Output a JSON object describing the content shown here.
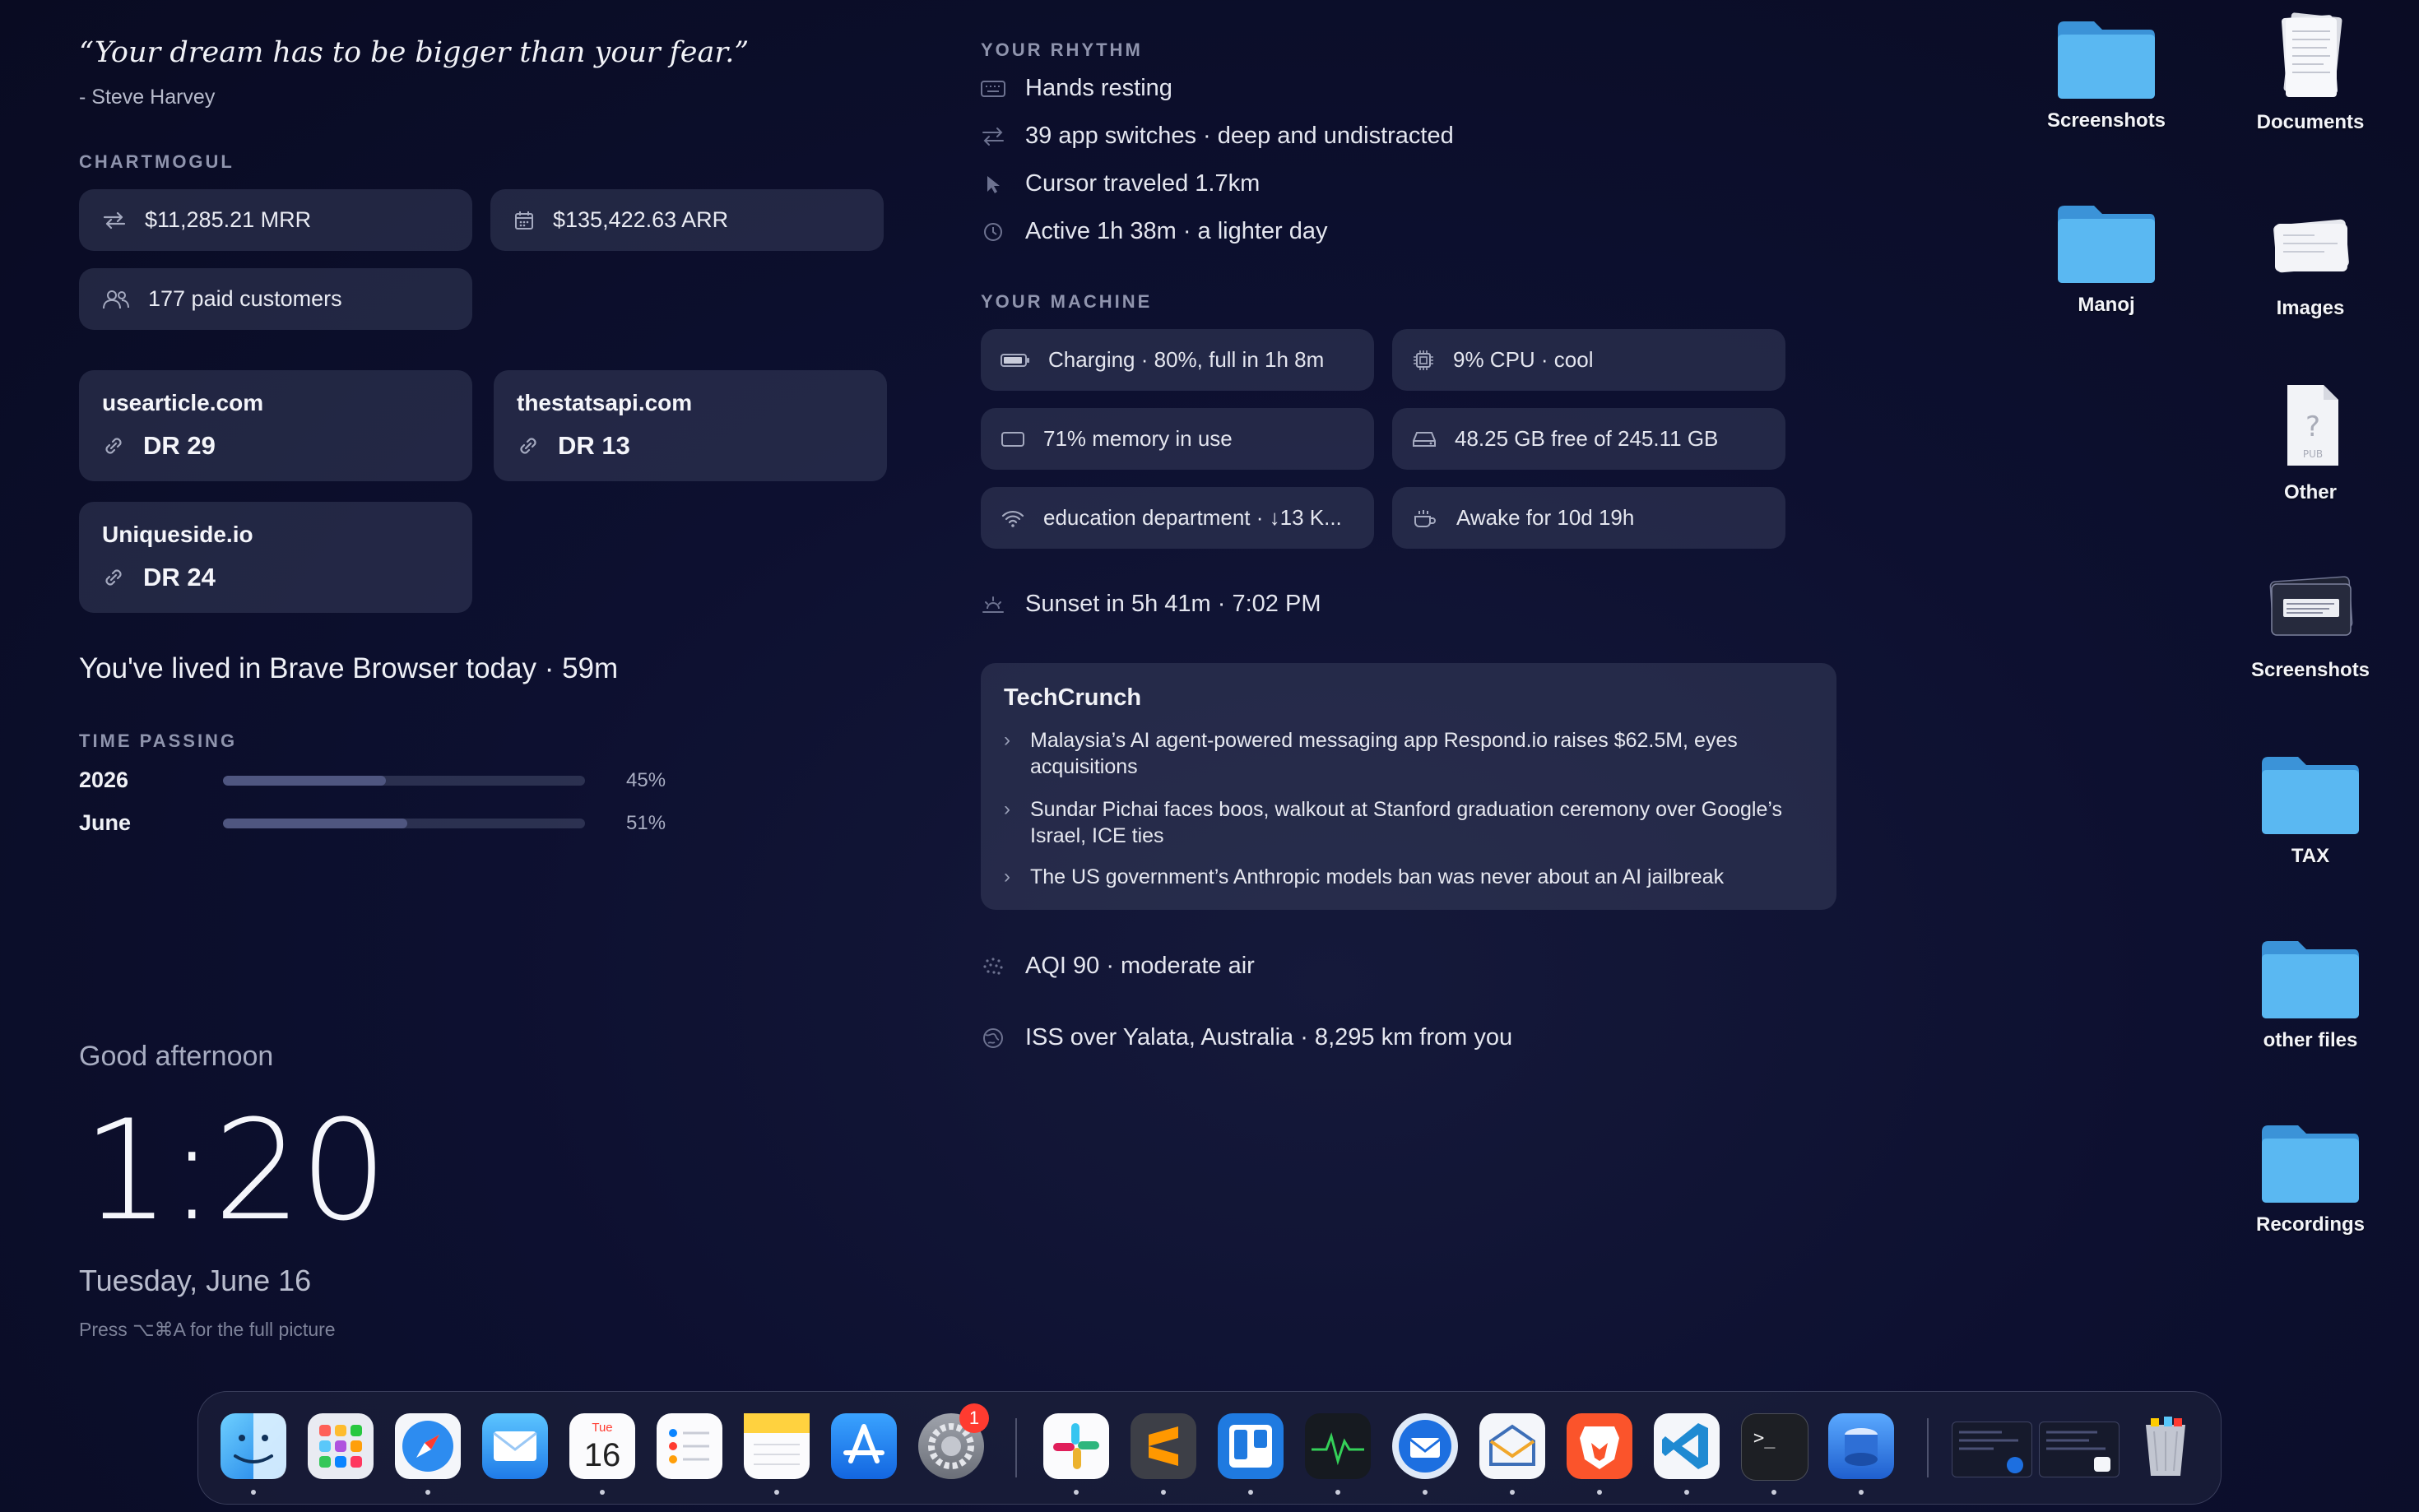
{
  "quote": {
    "text": "“Your dream has to be bigger than your fear.”",
    "author": "- Steve Harvey"
  },
  "chartmogul": {
    "label": "CHARTMOGUL",
    "mrr": "$11,285.21 MRR",
    "arr": "$135,422.63 ARR",
    "customers": "177 paid customers"
  },
  "sites": [
    {
      "name": "usearticle.com",
      "dr": "DR 29"
    },
    {
      "name": "thestatsapi.com",
      "dr": "DR 13"
    },
    {
      "name": "Uniqueside.io",
      "dr": "DR 24"
    }
  ],
  "lived": "You've lived in Brave Browser today · 59m",
  "time_passing": {
    "label": "TIME PASSING",
    "rows": [
      {
        "label": "2026",
        "value": 45,
        "pct": "45%"
      },
      {
        "label": "June",
        "value": 51,
        "pct": "51%"
      }
    ]
  },
  "clock": {
    "greeting": "Good afternoon",
    "time": "1:20",
    "date": "Tuesday, June 16",
    "hint": "Press ⌥⌘A for the full picture"
  },
  "rhythm": {
    "label": "YOUR RHYTHM",
    "items": [
      "Hands resting",
      "39 app switches · deep and undistracted",
      "Cursor traveled 1.7km",
      "Active 1h 38m · a lighter day"
    ]
  },
  "machine": {
    "label": "YOUR MACHINE",
    "battery": "Charging · 80%, full in 1h 8m",
    "cpu": "9% CPU · cool",
    "memory": "71% memory in use",
    "disk": "48.25 GB free of 245.11 GB",
    "wifi": "education department  · ↓13 K...",
    "uptime": "Awake for 10d 19h"
  },
  "sunset": "Sunset in 5h 41m · 7:02 PM",
  "techcrunch": {
    "title": "TechCrunch",
    "items": [
      "Malaysia’s AI agent-powered messaging app Respond.io raises $62.5M, eyes acquisitions",
      "Sundar Pichai faces boos, walkout at Stanford graduation ceremony over Google’s Israel, ICE ties",
      "The US government’s Anthropic models ban was never about an AI jailbreak"
    ]
  },
  "aqi": "AQI 90 · moderate air",
  "iss": "ISS over Yalata, Australia · 8,295 km from you",
  "desktop": {
    "left_column": [
      "Screenshots",
      "Manoj"
    ],
    "right_column": [
      "Documents",
      "Images",
      "Other",
      "Screenshots",
      "TAX",
      "other files",
      "Recordings"
    ]
  },
  "dock": {
    "calendar_month": "Tue",
    "calendar_day": "16",
    "settings_badge": "1",
    "terminal_prompt": ">_",
    "apps": [
      "finder",
      "launchpad",
      "safari",
      "mail",
      "calendar",
      "reminders",
      "notes",
      "app-store",
      "system-settings",
      "slack",
      "sublime-text",
      "trello",
      "activity-monitor",
      "thunderbird",
      "email-client",
      "brave",
      "vscode",
      "terminal",
      "preview",
      "window-thumbnails",
      "trash"
    ]
  },
  "colors": {
    "background": "#0d1030",
    "card": "#3c4260",
    "folder": "#4fb3ef",
    "accent_badge": "#ff3b30"
  }
}
